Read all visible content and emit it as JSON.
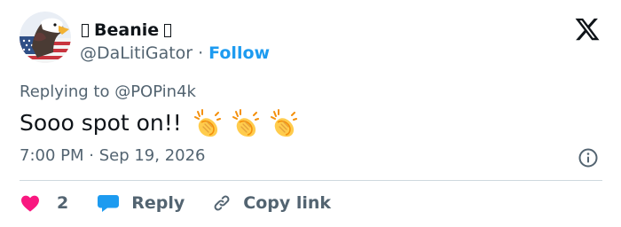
{
  "user": {
    "display_name": "Beanie",
    "handle": "@DaLitiGator",
    "separator": "·",
    "follow_label": "Follow"
  },
  "tweet": {
    "replying_to": "Replying to @POPin4k",
    "text": "Sooo spot on!!",
    "emoji": [
      "clapping-hands",
      "clapping-hands",
      "clapping-hands"
    ],
    "timestamp": "7:00 PM · Sep 19, 2026"
  },
  "actions": {
    "like_count": "2",
    "reply_label": "Reply",
    "copy_label": "Copy link"
  },
  "colors": {
    "accent": "#1d9bf0",
    "like": "#f91880",
    "text": "#0f1419",
    "muted": "#536471",
    "divider": "#cfd9de"
  }
}
